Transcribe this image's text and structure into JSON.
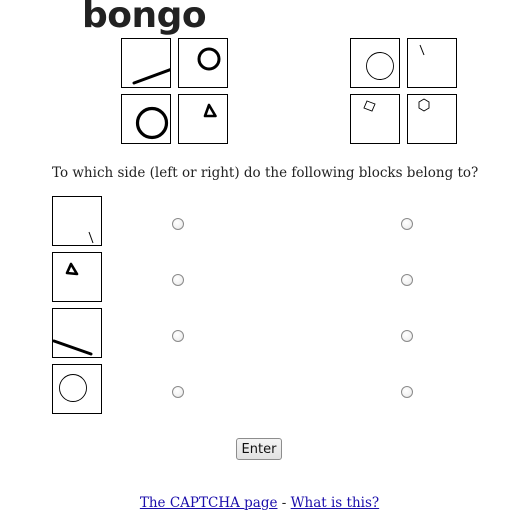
{
  "brand": {
    "logo_text": "bongo"
  },
  "question": "To which side (left or right) do the following blocks belong to?",
  "enter_label": "Enter",
  "footer": {
    "captcha_link": "The CAPTCHA page",
    "separator": " - ",
    "what_link": "What is this?"
  },
  "example_blocks": {
    "left": [
      "line",
      "ring",
      "ring",
      "triangle"
    ],
    "right": [
      "circle",
      "line",
      "square",
      "hexagon"
    ]
  },
  "test_blocks": [
    {
      "shape": "line",
      "answer": ""
    },
    {
      "shape": "triangle",
      "answer": ""
    },
    {
      "shape": "line",
      "answer": ""
    },
    {
      "shape": "circle",
      "answer": ""
    }
  ]
}
